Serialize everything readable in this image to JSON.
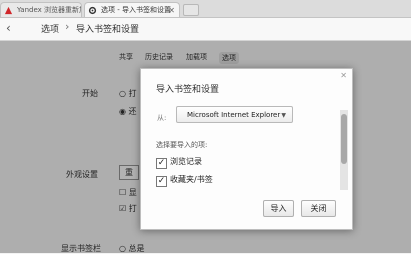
{
  "browser": {
    "tabs": [
      {
        "label": "Yandex 浏览器重新加"
      },
      {
        "label": "选项 - 导入书签和设置"
      }
    ]
  },
  "breadcrumb": {
    "root": "选项",
    "current": "导入书签和设置"
  },
  "settings": {
    "tabs": [
      {
        "label": "共享"
      },
      {
        "label": "历史记录"
      },
      {
        "label": "加载项"
      },
      {
        "label": "选项"
      }
    ],
    "labels": {
      "start": "开始",
      "appearance": "外观设置",
      "bookmarks_bar": "显示书签栏"
    },
    "fragments": {
      "start_opt1": "打",
      "start_opt2": "还",
      "appear_btn": "重",
      "appear_cb1": "显",
      "appear_cb2": "打",
      "bookmarks_opt": "总是"
    }
  },
  "dialog": {
    "title": "导入书签和设置",
    "from_label": "从:",
    "source": "Microsoft Internet Explorer",
    "pick_label": "选择要导入的项:",
    "items": [
      {
        "label": "浏览记录",
        "checked": true
      },
      {
        "label": "收藏夹/书签",
        "checked": true
      }
    ],
    "import_button": "导入",
    "close_button": "关闭"
  },
  "colors": {
    "accent_red": "#d0262a"
  }
}
